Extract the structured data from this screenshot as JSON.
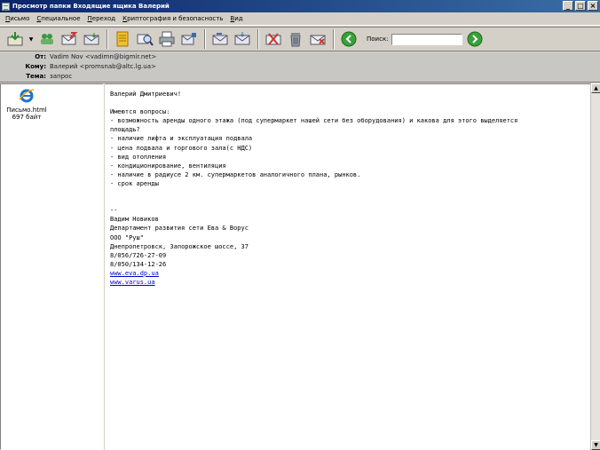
{
  "window": {
    "title": "Просмотр папки Входящие ящика Валерий",
    "buttons": [
      "_",
      "□",
      "×"
    ]
  },
  "menu": [
    {
      "accel": "П",
      "rest": "исьмо"
    },
    {
      "accel": "С",
      "rest": "пециальное"
    },
    {
      "accel": "П",
      "rest": "ереход"
    },
    {
      "accel": "К",
      "rest": "риптография и безопасность"
    },
    {
      "accel": "В",
      "rest": "ид"
    }
  ],
  "toolbar": {
    "search_label": "Поиск:",
    "search_value": ""
  },
  "header": {
    "from_label": "От:",
    "from_value": "Vadim Nov <vadimn@bigmir.net>",
    "to_label": "Кому:",
    "to_value": "Валерий <promsnab@altc.lg.ua>",
    "subject_label": "Тема:",
    "subject_value": "запрос"
  },
  "attachment": {
    "name": "Письмо.html",
    "size": "697 байт"
  },
  "message": {
    "greeting": "Валерий Дмитриевич!",
    "questions_intro": "Имеются вопросы:",
    "q1": "- возможность аренды одного этажа (под супермаркет нашей сети без оборудования) и какова для этого выделяется",
    "q1b": "площадь?",
    "q2": "- наличие лифта и эксплуатация подвала",
    "q3": "- цена подвала и торгового зала(с НДС)",
    "q4": "- вид отопления",
    "q5": "- кондиционирование, вентиляция",
    "q6": "- наличие в радиусе 2 км. супермаркетов аналогичного плана, рынков.",
    "q7": "- срок аренды",
    "sig_sep": "--",
    "sig_name": "Вадим Новиков",
    "sig_dept": "Департамент развития сети Ева & Ворус",
    "sig_company": "ООО \"Руш\"",
    "sig_address": "Днепропетровск, Запорожское шоссе, 37",
    "sig_phone1": "8/056/726-27-09",
    "sig_phone2": "8/050/134-12-26",
    "link1": "www.eva.dp.ua",
    "link2": "www.varus.ua"
  },
  "colors": {
    "titlebar": "#0a246a",
    "link": "#0000cc",
    "panel": "#d4d0c8"
  }
}
